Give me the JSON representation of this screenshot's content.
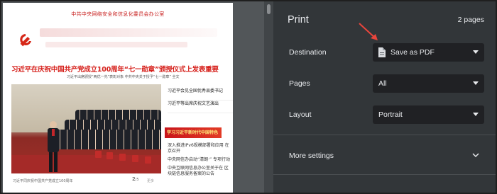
{
  "window": {
    "title": "Print"
  },
  "preview": {
    "org_title": "中共中央网络安全和信息化委员会办公室",
    "headline": "习近平在庆祝中国共产党成立100周年“七一勋章”颁授仪式上发表重要",
    "subline": "习近平出席颁授“两优一先”表彰对象  中共中央关于授予“七一勋章” 全文",
    "side_items": [
      "习近平会见全国优秀县委书记",
      "习近平等出席庆祝文艺演出"
    ],
    "red_banner": "学习习近平新时代中国特色",
    "side_items2": [
      "深入推进IPv6规模部署和应用 在京召开",
      "中央网信办启动“清朗·” 专项行动",
      "中央互联网信息办公室关于在 区块链信息服务备案的公告"
    ],
    "footer_caption": "习近平同庆祝中国共产党成立100周年",
    "page_current": "2",
    "page_total": "/5",
    "footer_link": "更多"
  },
  "settings": {
    "sheet_count": "2 pages",
    "destination": {
      "label": "Destination",
      "value": "Save as PDF"
    },
    "pages": {
      "label": "Pages",
      "value": "All"
    },
    "layout": {
      "label": "Layout",
      "value": "Portrait"
    },
    "more_settings": "More settings"
  },
  "colors": {
    "panel_bg": "#323639",
    "select_bg": "#202124",
    "text": "#e8eaed",
    "accent_arrow": "#e8453c",
    "headline_red": "#d6201b"
  },
  "icons": [
    "document-icon",
    "chevron-down-icon",
    "party-emblem-icon",
    "arrow-annotation-icon"
  ]
}
